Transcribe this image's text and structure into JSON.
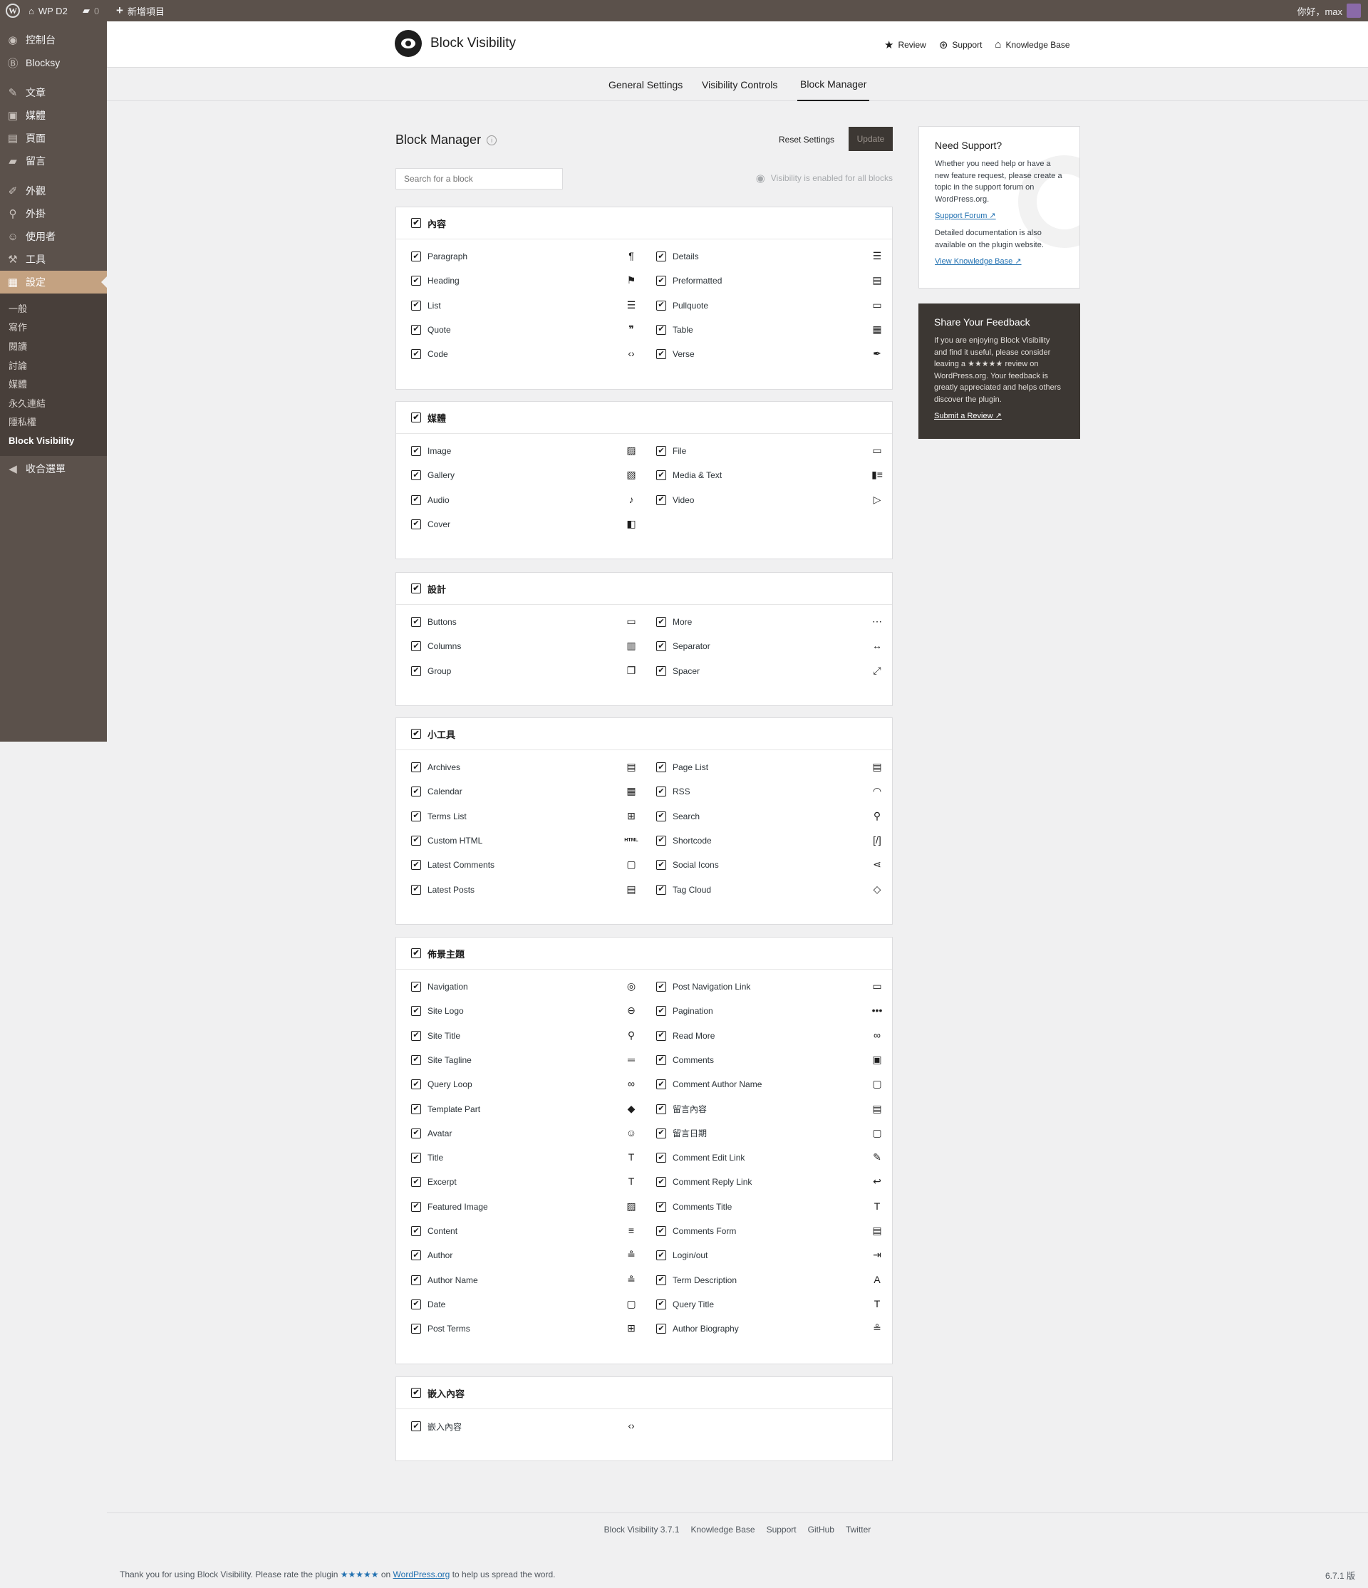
{
  "adminbar": {
    "site_name": "WP D2",
    "comments_count": "0",
    "new_label": "新增項目",
    "greeting": "你好，max"
  },
  "sidebar": {
    "items": [
      {
        "icon": "dashboard-icon",
        "glyph": "◉",
        "label": "控制台"
      },
      {
        "icon": "blocksy-icon",
        "glyph": "Ⓑ",
        "label": "Blocksy"
      },
      {
        "icon": "pin-icon",
        "glyph": "✎",
        "label": "文章"
      },
      {
        "icon": "media-icon",
        "glyph": "▣",
        "label": "媒體"
      },
      {
        "icon": "page-icon",
        "glyph": "▤",
        "label": "頁面"
      },
      {
        "icon": "comment-icon",
        "glyph": "▰",
        "label": "留言"
      },
      {
        "icon": "appearance-icon",
        "glyph": "✐",
        "label": "外觀"
      },
      {
        "icon": "plugin-icon",
        "glyph": "⚲",
        "label": "外掛"
      },
      {
        "icon": "users-icon",
        "glyph": "☺",
        "label": "使用者"
      },
      {
        "icon": "tools-icon",
        "glyph": "⚒",
        "label": "工具"
      },
      {
        "icon": "settings-icon",
        "glyph": "▦",
        "label": "設定"
      }
    ],
    "submenu": [
      "一般",
      "寫作",
      "閱讀",
      "討論",
      "媒體",
      "永久連結",
      "隱私權",
      "Block Visibility"
    ],
    "collapse_label": "收合選單"
  },
  "header": {
    "plugin_name": "Block Visibility",
    "links": [
      {
        "icon": "star-icon",
        "glyph": "★",
        "label": "Review"
      },
      {
        "icon": "support-icon",
        "glyph": "⊛",
        "label": "Support"
      },
      {
        "icon": "knowledge-base-icon",
        "glyph": "⌂",
        "label": "Knowledge Base"
      }
    ]
  },
  "tabs": [
    "General Settings",
    "Visibility Controls",
    "Block Manager"
  ],
  "main": {
    "title": "Block Manager",
    "reset_label": "Reset Settings",
    "update_label": "Update",
    "search_placeholder": "Search for a block",
    "visibility_note": "Visibility is enabled for all blocks"
  },
  "panels": [
    {
      "title": "內容",
      "blocks": [
        {
          "name": "Paragraph",
          "icon": "¶"
        },
        {
          "name": "Details",
          "icon": "☰"
        },
        {
          "name": "Heading",
          "icon": "⚑"
        },
        {
          "name": "Preformatted",
          "icon": "▤"
        },
        {
          "name": "List",
          "icon": "☰"
        },
        {
          "name": "Pullquote",
          "icon": "▭"
        },
        {
          "name": "Quote",
          "icon": "❞"
        },
        {
          "name": "Table",
          "icon": "▦"
        },
        {
          "name": "Code",
          "icon": "‹›"
        },
        {
          "name": "Verse",
          "icon": "✒"
        }
      ]
    },
    {
      "title": "媒體",
      "blocks": [
        {
          "name": "Image",
          "icon": "▨"
        },
        {
          "name": "File",
          "icon": "▭"
        },
        {
          "name": "Gallery",
          "icon": "▧"
        },
        {
          "name": "Media & Text",
          "icon": "▮≡"
        },
        {
          "name": "Audio",
          "icon": "♪"
        },
        {
          "name": "Video",
          "icon": "▷"
        },
        {
          "name": "Cover",
          "icon": "◧"
        }
      ]
    },
    {
      "title": "設計",
      "blocks": [
        {
          "name": "Buttons",
          "icon": "▭"
        },
        {
          "name": "More",
          "icon": "⋯"
        },
        {
          "name": "Columns",
          "icon": "▥"
        },
        {
          "name": "Separator",
          "icon": "↔"
        },
        {
          "name": "Group",
          "icon": "❐"
        },
        {
          "name": "Spacer",
          "icon": "⤢"
        }
      ]
    },
    {
      "title": "小工具",
      "blocks": [
        {
          "name": "Archives",
          "icon": "▤"
        },
        {
          "name": "Page List",
          "icon": "▤"
        },
        {
          "name": "Calendar",
          "icon": "▦"
        },
        {
          "name": "RSS",
          "icon": "◠"
        },
        {
          "name": "Terms List",
          "icon": "⊞"
        },
        {
          "name": "Search",
          "icon": "⚲"
        },
        {
          "name": "Custom HTML",
          "icon": "HTML"
        },
        {
          "name": "Shortcode",
          "icon": "[/]"
        },
        {
          "name": "Latest Comments",
          "icon": "▢"
        },
        {
          "name": "Social Icons",
          "icon": "⋖"
        },
        {
          "name": "Latest Posts",
          "icon": "▤"
        },
        {
          "name": "Tag Cloud",
          "icon": "◇"
        }
      ]
    },
    {
      "title": "佈景主題",
      "blocks": [
        {
          "name": "Navigation",
          "icon": "◎"
        },
        {
          "name": "Post Navigation Link",
          "icon": "▭"
        },
        {
          "name": "Site Logo",
          "icon": "⊖"
        },
        {
          "name": "Pagination",
          "icon": "•••"
        },
        {
          "name": "Site Title",
          "icon": "⚲"
        },
        {
          "name": "Read More",
          "icon": "∞"
        },
        {
          "name": "Site Tagline",
          "icon": "═"
        },
        {
          "name": "Comments",
          "icon": "▣"
        },
        {
          "name": "Query Loop",
          "icon": "∞"
        },
        {
          "name": "Comment Author Name",
          "icon": "▢"
        },
        {
          "name": "Template Part",
          "icon": "◆"
        },
        {
          "name": "留言內容",
          "icon": "▤"
        },
        {
          "name": "Avatar",
          "icon": "☺"
        },
        {
          "name": "留言日期",
          "icon": "▢"
        },
        {
          "name": "Title",
          "icon": "T"
        },
        {
          "name": "Comment Edit Link",
          "icon": "✎"
        },
        {
          "name": "Excerpt",
          "icon": "T"
        },
        {
          "name": "Comment Reply Link",
          "icon": "↩"
        },
        {
          "name": "Featured Image",
          "icon": "▨"
        },
        {
          "name": "Comments Title",
          "icon": "T"
        },
        {
          "name": "Content",
          "icon": "≡"
        },
        {
          "name": "Comments Form",
          "icon": "▤"
        },
        {
          "name": "Author",
          "icon": "≗"
        },
        {
          "name": "Login/out",
          "icon": "⇥"
        },
        {
          "name": "Author Name",
          "icon": "≗"
        },
        {
          "name": "Term Description",
          "icon": "A"
        },
        {
          "name": "Date",
          "icon": "▢"
        },
        {
          "name": "Query Title",
          "icon": "T"
        },
        {
          "name": "Post Terms",
          "icon": "⊞"
        },
        {
          "name": "Author Biography",
          "icon": "≗"
        }
      ]
    },
    {
      "title": "嵌入內容",
      "blocks": [
        {
          "name": "嵌入內容",
          "icon": "‹›"
        }
      ]
    }
  ],
  "support_card": {
    "title": "Need Support?",
    "text1": "Whether you need help or have a new feature request, please create a topic in the support forum on WordPress.org.",
    "link1": "Support Forum ↗",
    "text2": "Detailed documentation is also available on the plugin website.",
    "link2": "View Knowledge Base ↗"
  },
  "feedback_card": {
    "title": "Share Your Feedback",
    "text": "If you are enjoying Block Visibility and find it useful, please consider leaving a ★★★★★ review on WordPress.org. Your feedback is greatly appreciated and helps others discover the plugin.",
    "link": "Submit a Review ↗"
  },
  "plugin_footer": [
    "Block Visibility 3.7.1",
    "Knowledge Base",
    "Support",
    "GitHub",
    "Twitter"
  ],
  "admin_footer": {
    "text_before": "Thank you for using Block Visibility. Please rate the plugin ",
    "stars": "★★★★★",
    "text_on": " on ",
    "link": "WordPress.org",
    "text_after": " to help us spread the word.",
    "version": "6.7.1 版"
  },
  "colors": {
    "sidebar": "#5b514b",
    "accent": "#c4a281",
    "link": "#2271b1",
    "dark_card": "#3c3733"
  }
}
